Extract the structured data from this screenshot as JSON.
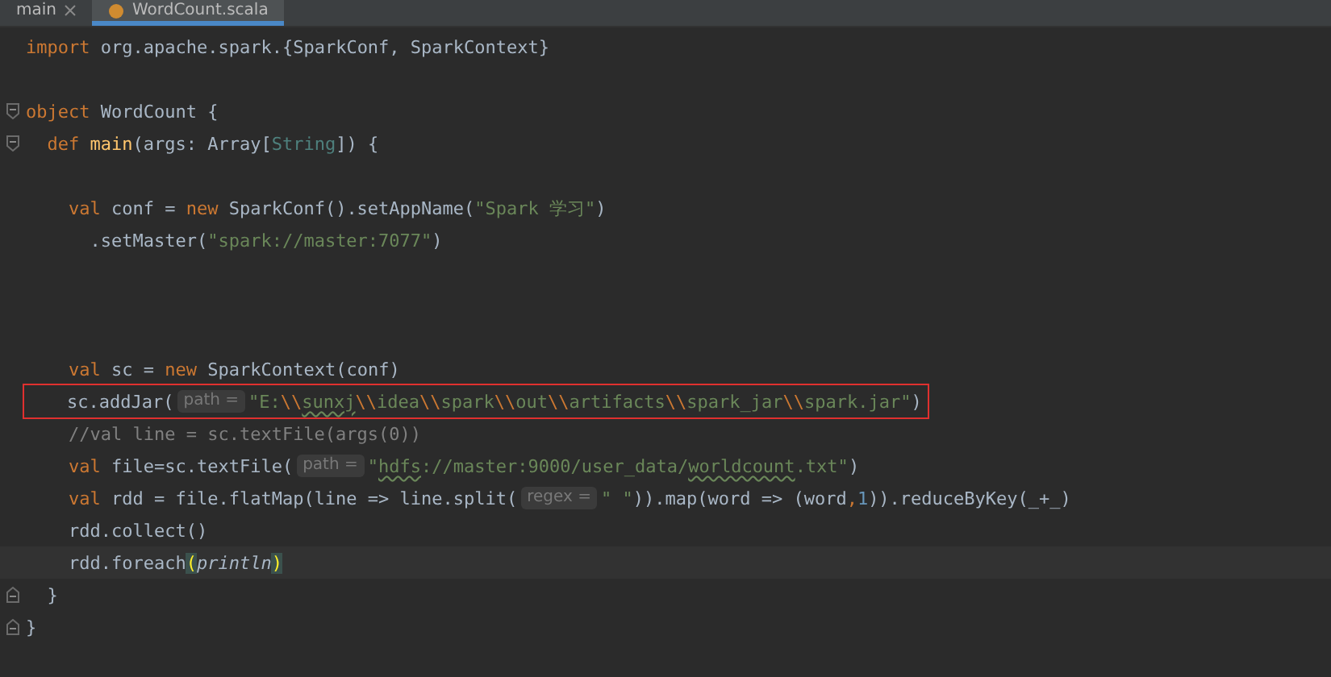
{
  "tabs": [
    {
      "label": "main",
      "selected": false,
      "closable": true
    },
    {
      "label": "WordCount.scala",
      "selected": true,
      "closable": false
    }
  ],
  "lines": [
    {
      "kind": "code",
      "tokens": [
        {
          "kind": "kw",
          "text": "import"
        },
        {
          "kind": "plain",
          "text": " org.apache.spark.{SparkConf, SparkContext}"
        }
      ]
    },
    {
      "kind": "blank"
    },
    {
      "kind": "fold_start",
      "tokens": [
        {
          "kind": "kw",
          "text": "object"
        },
        {
          "kind": "plain",
          "text": " WordCount {"
        }
      ]
    },
    {
      "kind": "fold_start",
      "tokens": [
        {
          "kind": "kw",
          "text": "  def "
        },
        {
          "kind": "fn",
          "text": "main"
        },
        {
          "kind": "plain",
          "text": "(args: Array["
        },
        {
          "kind": "type",
          "text": "String"
        },
        {
          "kind": "plain",
          "text": "]) {"
        }
      ]
    },
    {
      "kind": "blank"
    },
    {
      "kind": "code",
      "tokens": [
        {
          "kind": "kw",
          "text": "    val"
        },
        {
          "kind": "plain",
          "text": " conf = "
        },
        {
          "kind": "kw",
          "text": "new"
        },
        {
          "kind": "plain",
          "text": " SparkConf().setAppName("
        },
        {
          "kind": "str",
          "text": "\"Spark 学习\""
        },
        {
          "kind": "plain",
          "text": ")"
        }
      ]
    },
    {
      "kind": "code",
      "tokens": [
        {
          "kind": "plain",
          "text": "      .setMaster("
        },
        {
          "kind": "str",
          "text": "\"spark://master:7077\""
        },
        {
          "kind": "plain",
          "text": ")"
        }
      ]
    },
    {
      "kind": "blank"
    },
    {
      "kind": "blank"
    },
    {
      "kind": "blank"
    },
    {
      "kind": "code",
      "tokens": [
        {
          "kind": "kw",
          "text": "    val"
        },
        {
          "kind": "plain",
          "text": " sc = "
        },
        {
          "kind": "kw",
          "text": "new"
        },
        {
          "kind": "plain",
          "text": " SparkContext(conf)"
        }
      ]
    },
    {
      "kind": "code",
      "boxed": true,
      "tokens": [
        {
          "kind": "plain",
          "text": "    sc.addJar("
        },
        {
          "kind": "hint",
          "text": "path ="
        },
        {
          "kind": "str",
          "text": "\"E:"
        },
        {
          "kind": "esc",
          "text": "\\\\"
        },
        {
          "kind": "typo",
          "text": "sunxj"
        },
        {
          "kind": "esc",
          "text": "\\\\"
        },
        {
          "kind": "str",
          "text": "idea"
        },
        {
          "kind": "esc",
          "text": "\\\\"
        },
        {
          "kind": "str",
          "text": "spark"
        },
        {
          "kind": "esc",
          "text": "\\\\"
        },
        {
          "kind": "str",
          "text": "out"
        },
        {
          "kind": "esc",
          "text": "\\\\"
        },
        {
          "kind": "str",
          "text": "artifacts"
        },
        {
          "kind": "esc",
          "text": "\\\\"
        },
        {
          "kind": "str",
          "text": "spark_jar"
        },
        {
          "kind": "esc",
          "text": "\\\\"
        },
        {
          "kind": "str",
          "text": "spark.jar\""
        },
        {
          "kind": "plain",
          "text": ")"
        }
      ]
    },
    {
      "kind": "code",
      "tokens": [
        {
          "kind": "comment",
          "text": "    //val line = sc.textFile(args(0))"
        }
      ]
    },
    {
      "kind": "code",
      "tokens": [
        {
          "kind": "kw",
          "text": "    val"
        },
        {
          "kind": "plain",
          "text": " file=sc.textFile("
        },
        {
          "kind": "hint",
          "text": "path ="
        },
        {
          "kind": "str",
          "text": "\""
        },
        {
          "kind": "typo",
          "text": "hdfs"
        },
        {
          "kind": "str",
          "text": "://master:9000/user_data/"
        },
        {
          "kind": "typo",
          "text": "worldcount"
        },
        {
          "kind": "str",
          "text": ".txt\""
        },
        {
          "kind": "plain",
          "text": ")"
        }
      ]
    },
    {
      "kind": "code",
      "tokens": [
        {
          "kind": "kw",
          "text": "    val"
        },
        {
          "kind": "plain",
          "text": " rdd = file.flatMap(line => line.split("
        },
        {
          "kind": "hint",
          "text": "regex ="
        },
        {
          "kind": "str",
          "text": "\" \""
        },
        {
          "kind": "plain",
          "text": ")).map(word => (word"
        },
        {
          "kind": "kw",
          "text": ","
        },
        {
          "kind": "num",
          "text": "1"
        },
        {
          "kind": "plain",
          "text": ")).reduceByKey(_+_)"
        }
      ]
    },
    {
      "kind": "code",
      "tokens": [
        {
          "kind": "plain",
          "text": "    rdd.collect()"
        }
      ]
    },
    {
      "kind": "code",
      "current": true,
      "tokens": [
        {
          "kind": "plain",
          "text": "    rdd.foreach"
        },
        {
          "kind": "match",
          "text": "("
        },
        {
          "kind": "italic",
          "text": "println"
        },
        {
          "kind": "match",
          "text": ")"
        }
      ]
    },
    {
      "kind": "fold_end",
      "tokens": [
        {
          "kind": "plain",
          "text": "  }"
        }
      ]
    },
    {
      "kind": "fold_end",
      "tokens": [
        {
          "kind": "plain",
          "text": "}"
        }
      ]
    }
  ]
}
